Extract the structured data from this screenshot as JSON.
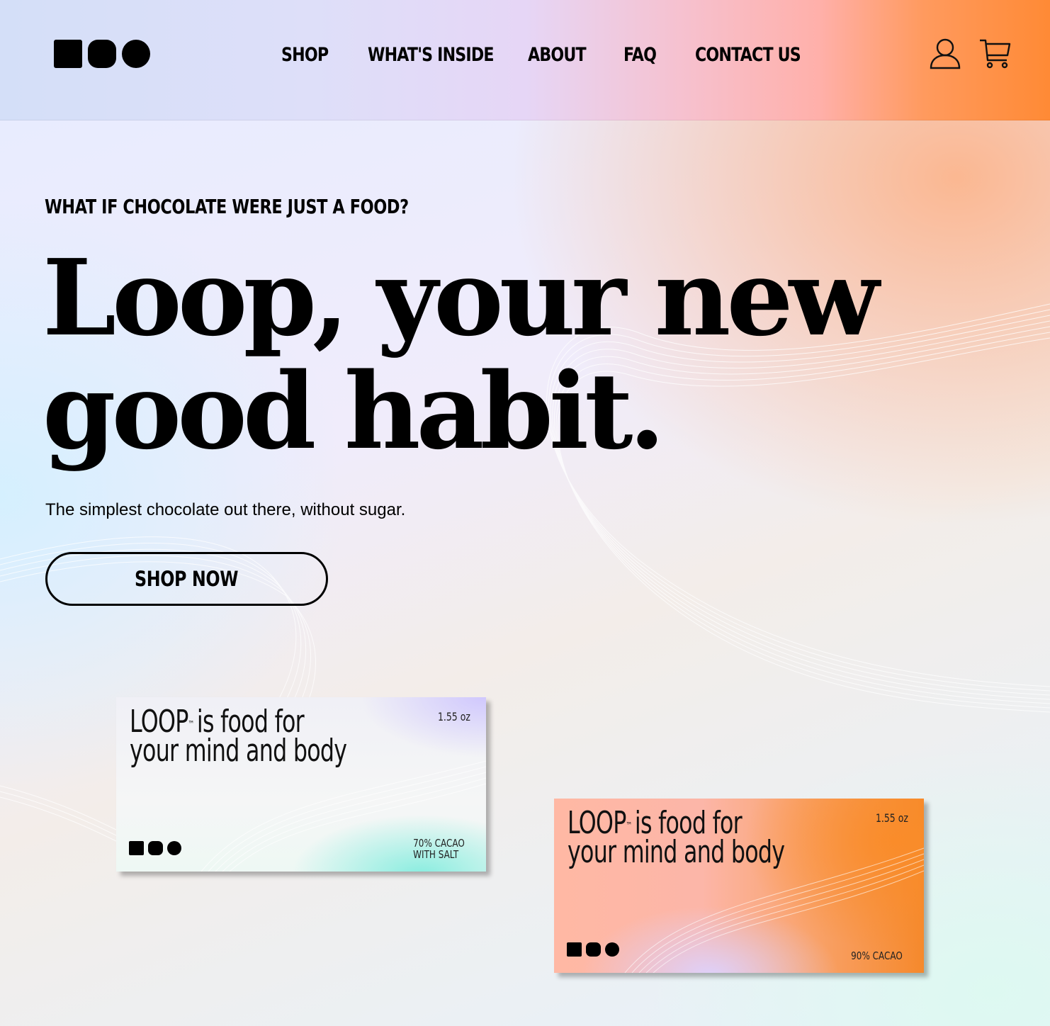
{
  "brand": {
    "logo_name": "loop-logo"
  },
  "nav": {
    "items": [
      {
        "label": "SHOP"
      },
      {
        "label": "WHAT'S INSIDE"
      },
      {
        "label": "ABOUT"
      },
      {
        "label": "FAQ"
      },
      {
        "label": "CONTACT US"
      }
    ]
  },
  "header_icons": {
    "account": "user-icon",
    "cart": "cart-icon"
  },
  "hero": {
    "eyebrow": "WHAT IF CHOCOLATE WERE JUST A FOOD?",
    "headline_line1": "Loop, your new",
    "headline_line2": "good habit.",
    "subtext": "The simplest chocolate out there, without sugar.",
    "cta_label": "SHOP NOW"
  },
  "products": [
    {
      "title_brand": "LOOP",
      "title_tm": "™",
      "title_rest": "is food for",
      "title_line2": "your mind and body",
      "weight": "1.55 oz",
      "flavor_line1": "70% CACAO",
      "flavor_line2": "WITH SALT"
    },
    {
      "title_brand": "LOOP",
      "title_tm": "™",
      "title_rest": "is food for",
      "title_line2": "your mind and body",
      "weight": "1.55 oz",
      "flavor_line1": "90% CACAO",
      "flavor_line2": ""
    }
  ],
  "colors": {
    "accent_orange": "#ff8a35",
    "text": "#000000"
  }
}
